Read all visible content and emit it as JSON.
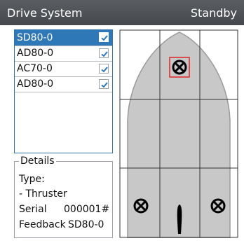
{
  "titlebar": {
    "title": "Drive System",
    "status": "Standby"
  },
  "drives": [
    {
      "name": "SD80-0",
      "checked": true,
      "selected": true
    },
    {
      "name": "AD80-0",
      "checked": true,
      "selected": false
    },
    {
      "name": "AC70-0",
      "checked": true,
      "selected": false
    },
    {
      "name": "AD80-0",
      "checked": true,
      "selected": false
    }
  ],
  "details": {
    "heading": "Details",
    "type_label": "Type:",
    "type_value": "- Thruster",
    "serial_label": "Serial",
    "serial_value": "000001#",
    "feedback_label": "Feedback",
    "feedback_value": "SD80-0"
  },
  "colors": {
    "accent": "#2e78b8",
    "hull": "#c8c8c8",
    "highlight": "#e0262a"
  },
  "boat_view": {
    "icons": [
      "thruster-bow-icon",
      "thruster-port-icon",
      "rudder-icon",
      "thruster-starboard-icon"
    ]
  }
}
